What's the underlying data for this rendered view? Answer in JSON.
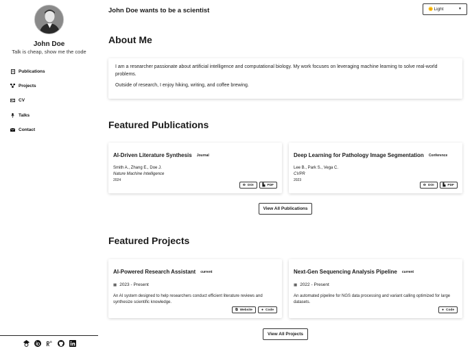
{
  "sidebar": {
    "name": "John Doe",
    "tagline": "Talk is cheap, show me the code",
    "nav": [
      {
        "label": "Publications",
        "icon": "document-icon"
      },
      {
        "label": "Projects",
        "icon": "projects-icon"
      },
      {
        "label": "CV",
        "icon": "id-card-icon"
      },
      {
        "label": "Talks",
        "icon": "microphone-icon"
      },
      {
        "label": "Contact",
        "icon": "envelope-icon"
      }
    ],
    "social": [
      "google-scholar-icon",
      "orcid-icon",
      "researchgate-icon",
      "github-icon",
      "linkedin-icon"
    ]
  },
  "header": {
    "title": "John Doe wants to be a scientist",
    "theme": "Light"
  },
  "about": {
    "heading": "About Me",
    "p1": "I am a researcher passionate about artificial intelligence and computational biology. My work focuses on leveraging machine learning to solve real-world problems.",
    "p2": "Outside of research, I enjoy hiking, writing, and coffee brewing."
  },
  "publications": {
    "heading": "Featured Publications",
    "items": [
      {
        "title": "AI-Driven Literature Synthesis",
        "type": "Journal",
        "authors": "Smith A., Zhang E., Doe J.",
        "venue": "Nature Machine Intelligence",
        "year": "2024"
      },
      {
        "title": "Deep Learning for Pathology Image Segmentation",
        "type": "Conference",
        "authors": "Lee B., Park S., Vega C.",
        "venue": "CVPR",
        "year": "2023"
      }
    ],
    "doi_label": "DOI",
    "pdf_label": "PDF",
    "view_all": "View All Publications"
  },
  "projects": {
    "heading": "Featured Projects",
    "items": [
      {
        "title": "AI-Powered Research Assistant",
        "status": "current",
        "dates": "2023 - Present",
        "desc": "An AI system designed to help researchers conduct efficient literature reviews and synthesize scientific knowledge."
      },
      {
        "title": "Next-Gen Sequencing Analysis Pipeline",
        "status": "current",
        "dates": "2022 - Present",
        "desc": "An automated pipeline for NGS data processing and variant calling optimized for large datasets."
      }
    ],
    "website_label": "Website",
    "code_label": "Code",
    "view_all": "View All Projects"
  }
}
